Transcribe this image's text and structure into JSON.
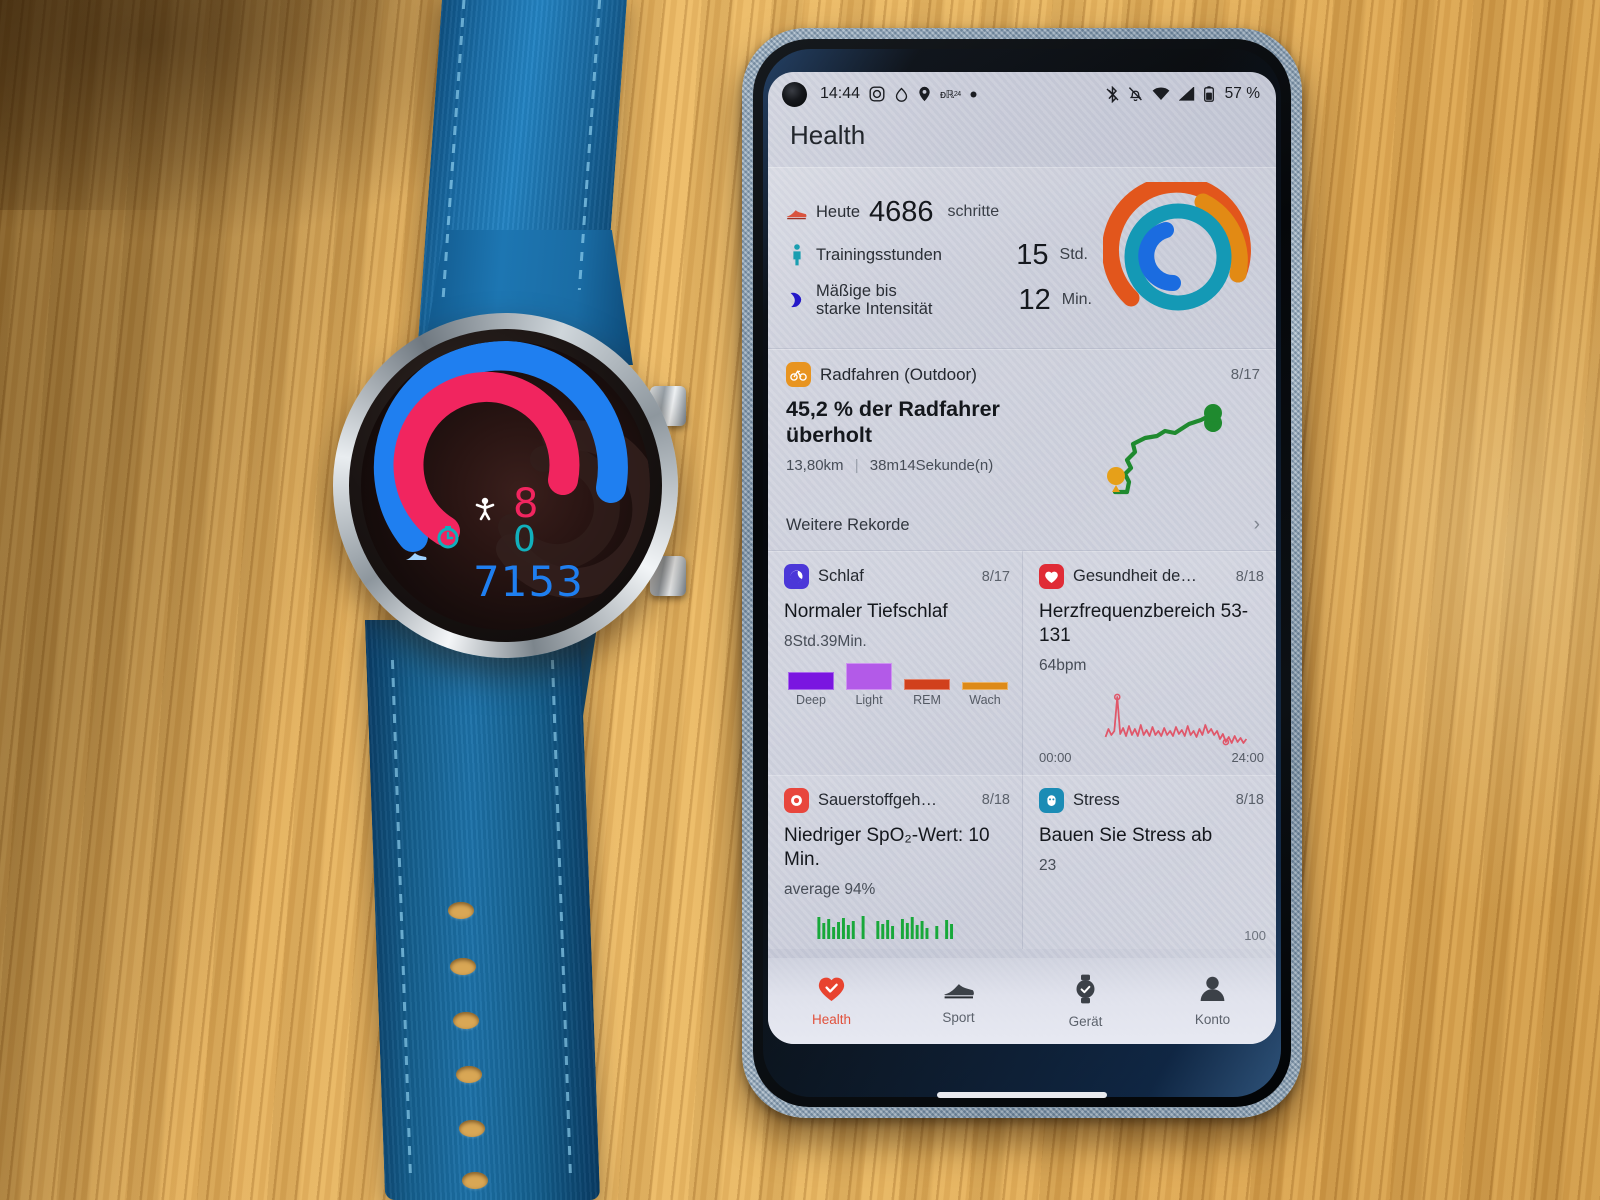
{
  "statusbar": {
    "time": "14:44",
    "battery_percent": "57 %",
    "icons_left": [
      "instagram-icon",
      "cloud-icon",
      "location-pin-icon",
      "app-badge-icon",
      "dot-icon"
    ],
    "icons_right": [
      "bluetooth-icon",
      "alarm-off-icon",
      "wifi-icon",
      "signal-icon",
      "battery-icon"
    ]
  },
  "app": {
    "title": "Health"
  },
  "summary": {
    "steps": {
      "label": "Heute",
      "value": "4686",
      "unit": "schritte",
      "icon": "running-shoe-icon"
    },
    "training": {
      "label": "Trainingsstunden",
      "value": "15",
      "unit": "Std.",
      "icon": "standing-person-icon"
    },
    "intensity": {
      "label": "Mäßige bis starke Intensität",
      "value": "12",
      "unit": "Min.",
      "icon": "flexed-arm-icon"
    },
    "rings": {
      "outer_color": "#e2561c",
      "middle_color": "#1499b5",
      "inner_color": "#1b6ce0",
      "outer_percent": 66,
      "middle_percent": 92,
      "inner_percent": 38
    }
  },
  "cycling": {
    "icon": "bicycle-icon",
    "title": "Radfahren (Outdoor)",
    "date": "8/17",
    "headline": "45,2 % der Radfahrer überholt",
    "distance": "13,80km",
    "duration": "38m14Sekunde(n)",
    "more_label": "Weitere Rekorde",
    "route_color": "#1f8a2f",
    "start_marker_color": "#e6a019",
    "end_marker_color": "#1f8a2f"
  },
  "cards": {
    "sleep": {
      "icon": "sleep-moon-icon",
      "title": "Schlaf",
      "date": "8/17",
      "headline": "Normaler Tiefschlaf",
      "sub": "8Std.39Min.",
      "stages": [
        {
          "label": "Deep",
          "color": "#7a16e0",
          "height": 18
        },
        {
          "label": "Light",
          "color": "#b35ae8",
          "height": 27
        },
        {
          "label": "REM",
          "color": "#d1401c",
          "height": 11
        },
        {
          "label": "Wach",
          "color": "#dd8a18",
          "height": 8
        }
      ]
    },
    "heart": {
      "icon": "heart-icon",
      "title": "Gesundheit de…",
      "date": "8/18",
      "headline": "Herzfrequenzbereich 53-131",
      "sub": "64bpm",
      "axis_start": "00:00",
      "axis_end": "24:00",
      "line_color": "#e0576a"
    },
    "spo2": {
      "icon": "oxygen-icon",
      "title": "Sauerstoffgeh…",
      "date": "8/18",
      "headline": "Niedriger SpO₂-Wert: 10 Min.",
      "sub": "average  94%",
      "bar_color": "#18a83a"
    },
    "stress": {
      "icon": "stress-icon",
      "title": "Stress",
      "date": "8/18",
      "headline": "Bauen Sie Stress ab",
      "sub": "23",
      "scale_max": "100"
    }
  },
  "bottomnav": {
    "items": [
      {
        "label": "Health",
        "icon": "heart-icon",
        "active": true
      },
      {
        "label": "Sport",
        "icon": "shoe-icon",
        "active": false
      },
      {
        "label": "Gerät",
        "icon": "watch-icon",
        "active": false
      },
      {
        "label": "Konto",
        "icon": "person-icon",
        "active": false
      }
    ]
  },
  "watch": {
    "face": {
      "ring_outer_color": "#1f7ff0",
      "ring_middle_color": "#f1255f",
      "ring_inner_color": "#1f7ff0",
      "value_pink": "8",
      "value_teal": "0",
      "value_blue": "7153"
    },
    "band_color": "#1a6ea8",
    "case_finish": "polished-steel"
  }
}
